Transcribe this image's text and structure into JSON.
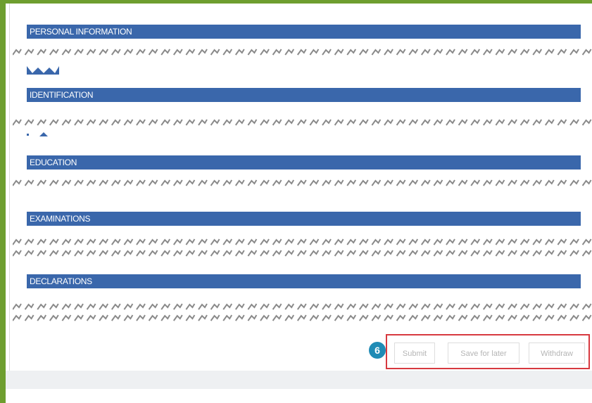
{
  "sections": [
    {
      "title": "PERSONAL INFORMATION"
    },
    {
      "title": "IDENTIFICATION"
    },
    {
      "title": "EDUCATION"
    },
    {
      "title": "EXAMINATIONS"
    },
    {
      "title": "DECLARATIONS"
    }
  ],
  "actions": {
    "step_number": "6",
    "submit_label": "Submit",
    "save_label": "Save for later",
    "withdraw_label": "Withdraw"
  },
  "colors": {
    "frame": "#6e9e2f",
    "section_header": "#3a67ab",
    "highlight_border": "#d7393f",
    "step_badge": "#1f8bb5"
  }
}
